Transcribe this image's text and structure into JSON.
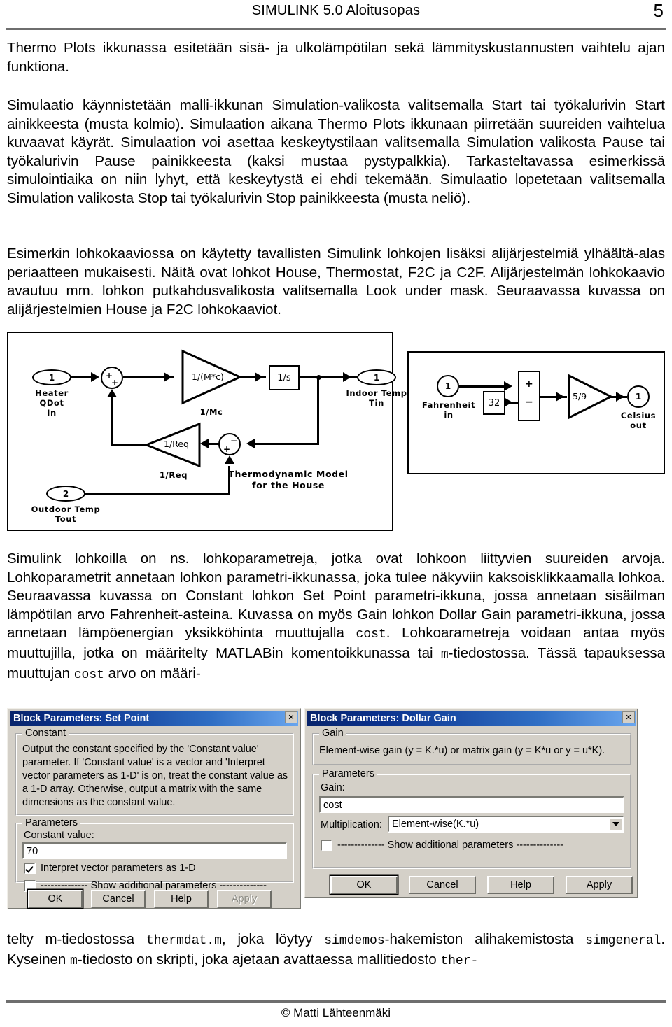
{
  "header": {
    "title": "SIMULINK 5.0 Aloitusopas",
    "page_number": "5"
  },
  "paragraphs": {
    "p1": "Thermo Plots ikkunassa esitetään sisä- ja ulkolämpötilan sekä lämmityskustannusten vaihtelu ajan funktiona.",
    "p2": "Simulaatio käynnistetään malli-ikkunan Simulation-valikosta valitsemalla Start tai työkalurivin Start ainikkeesta (musta kolmio). Simulaation aikana Thermo Plots ikkunaan piirretään suureiden vaihtelua kuvaavat käyrät. Simulaation voi asettaa keskeytystilaan valitsemalla Simulation valikosta Pause tai työkalurivin Pause painikkeesta (kaksi mustaa pystypalkkia). Tarkasteltavassa esimerkissä simulointiaika on niin lyhyt, että keskeytystä ei ehdi tekemään. Simulaatio lopetetaan valitsemalla Simulation valikosta Stop tai työkalurivin Stop painikkeesta (musta neliö).",
    "p3": "Esimerkin lohkokaaviossa on käytetty tavallisten Simulink lohkojen lisäksi alijärjestelmiä ylhäältä-alas periaatteen mukaisesti. Näitä ovat lohkot House, Thermostat, F2C ja C2F. Alijärjestelmän lohkokaavio avautuu mm. lohkon putkahdusvalikosta valitsemalla Look under mask. Seuraavassa kuvassa on alijärjestelmien House ja F2C lohkokaaviot.",
    "p4_a": "Simulink lohkoilla on ns. lohkoparametreja, jotka ovat lohkoon liittyvien suureiden arvoja. Lohkoparametrit annetaan lohkon parametri-ikkunassa, joka tulee näkyviin kaksoisklikkaamalla lohkoa. Seuraavassa kuvassa on Constant lohkon Set Point parametri-ikkuna, jossa annetaan sisäilman lämpötilan arvo Fahrenheit-asteina. Kuvassa on myös Gain lohkon Dollar Gain parametri-ikkuna, jossa annetaan lämpöenergian yksikköhinta muuttujalla ",
    "p4_code1": "cost",
    "p4_b": ". Lohkoarametreja voidaan antaa myös muuttujilla, jotka on määritelty MATLABin komentoikkunassa tai ",
    "p4_code2": "m",
    "p4_c": "-tiedostossa. Tässä tapauksessa muuttujan ",
    "p4_code3": "cost",
    "p4_d": " arvo on määri-",
    "p5_a": "telty m-tiedostossa ",
    "p5_code1": "thermdat.m",
    "p5_b": ", joka löytyy ",
    "p5_code2": "simdemos",
    "p5_c": "-hakemiston alihakemistosta ",
    "p5_code3": "simgeneral",
    "p5_d": ". Kyseinen ",
    "p5_code4": "m",
    "p5_e": "-tiedosto on skripti, joka ajetaan avattaessa mallitiedosto ",
    "p5_code5": "ther-"
  },
  "figure_house": {
    "caption_line1": "Thermodynamic Model",
    "caption_line2": "for the House",
    "in1_port": "1",
    "in1_label_line1": "Heater",
    "in1_label_line2": "QDot",
    "in1_label_line3": "In",
    "in2_port": "2",
    "in2_label_line1": "Outdoor Temp",
    "in2_label_line2": "Tout",
    "out1_port": "1",
    "out1_label_line1": "Indoor Temp",
    "out1_label_line2": "Tin",
    "gain1_text": "1/(M*c)",
    "gain1_label": "1/Mc",
    "gain2_text": "1/Req",
    "gain2_label": "1/Req",
    "integrator_text": "1/s",
    "sum1_sign_a": "+",
    "sum1_sign_b": "+",
    "sum2_sign_a": "+",
    "sum2_sign_b": "−"
  },
  "figure_f2c": {
    "in1_port": "1",
    "in1_label_line1": "Fahrenheit",
    "in1_label_line2": "in",
    "const_value": "32",
    "sum_plus": "+",
    "sum_minus": "−",
    "gain_text": "5/9",
    "out1_port": "1",
    "out1_label_line1": "Celsius",
    "out1_label_line2": "out"
  },
  "dialog_setpoint": {
    "title": "Block Parameters: Set Point",
    "close_glyph": "✕",
    "group1_legend": "Constant",
    "group1_desc": "Output the constant specified by the 'Constant value' parameter. If 'Constant value' is a vector and 'Interpret vector parameters as 1-D' is on, treat the constant value as a 1-D array. Otherwise, output a matrix with the same dimensions as the constant value.",
    "group2_legend": "Parameters",
    "constant_value_label": "Constant value:",
    "constant_value": "70",
    "checkbox1_label": "Interpret vector parameters as 1-D",
    "checkbox2_label": "-------------- Show additional parameters --------------",
    "btn_ok": "OK",
    "btn_cancel": "Cancel",
    "btn_help": "Help",
    "btn_apply": "Apply"
  },
  "dialog_gain": {
    "title": "Block Parameters: Dollar Gain",
    "close_glyph": "✕",
    "group1_legend": "Gain",
    "group1_desc": "Element-wise gain (y = K.*u) or matrix gain (y = K*u or y = u*K).",
    "group2_legend": "Parameters",
    "gain_label": "Gain:",
    "gain_value": "cost",
    "multiplication_label": "Multiplication:",
    "multiplication_value": "Element-wise(K.*u)",
    "checkbox_label": "-------------- Show additional parameters --------------",
    "btn_ok": "OK",
    "btn_cancel": "Cancel",
    "btn_help": "Help",
    "btn_apply": "Apply"
  },
  "footer": {
    "copyright": "© Matti Lähteenmäki"
  }
}
